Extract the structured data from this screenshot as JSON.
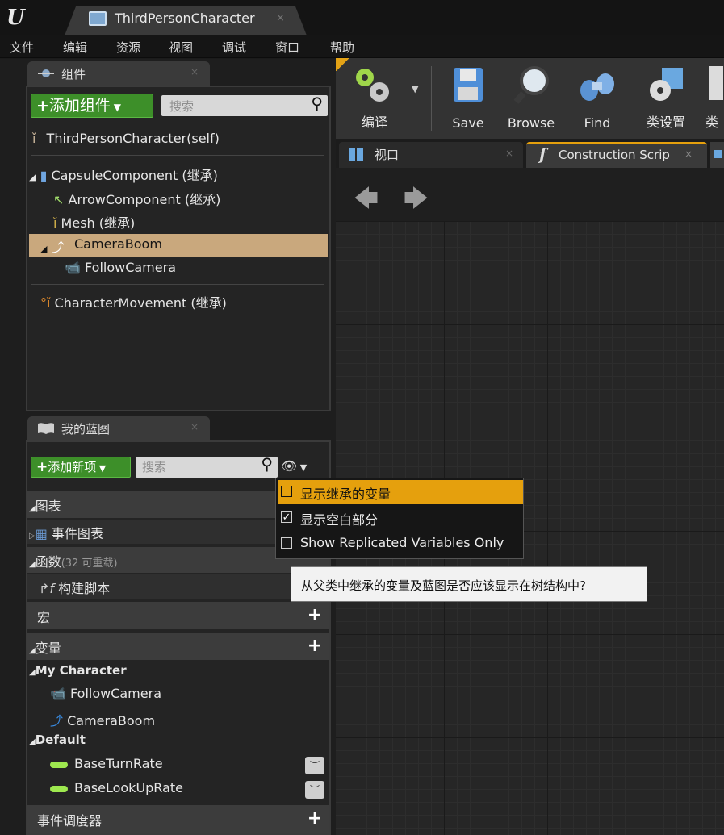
{
  "window": {
    "tab_title": "ThirdPersonCharacter",
    "tab_close": "×"
  },
  "menubar": {
    "items": [
      "文件",
      "编辑",
      "资源",
      "视图",
      "调试",
      "窗口",
      "帮助"
    ]
  },
  "components_panel": {
    "tab_label": "组件",
    "tab_close": "×",
    "add_button": "添加组件",
    "search_placeholder": "搜索",
    "self_item": "ThirdPersonCharacter(self)",
    "tree": [
      {
        "label": "CapsuleComponent (继承)"
      },
      {
        "label": "ArrowComponent (继承)"
      },
      {
        "label": "Mesh (继承)"
      },
      {
        "label": "CameraBoom"
      },
      {
        "label": "FollowCamera"
      },
      {
        "label": "CharacterMovement (继承)"
      }
    ]
  },
  "myblueprint_panel": {
    "tab_label": "我的蓝图",
    "tab_close": "×",
    "add_button": "添加新项",
    "search_placeholder": "搜索",
    "graphs_header": "图表",
    "event_graph": "事件图表",
    "functions_header": "函数",
    "functions_count": "(32 可重载)",
    "construction_script": "构建脚本",
    "macros_header": "宏",
    "variables_header": "变量",
    "group_my_character": "My Character",
    "var_follow_camera": "FollowCamera",
    "var_camera_boom": "CameraBoom",
    "group_default": "Default",
    "var_base_turn_rate": "BaseTurnRate",
    "var_base_lookup_rate": "BaseLookUpRate",
    "event_dispatchers_header": "事件调度器"
  },
  "toolbar": {
    "compile": "编译",
    "save": "Save",
    "browse": "Browse",
    "find": "Find",
    "class_settings": "类设置",
    "class_defaults_partial": "类"
  },
  "graph_tabs": {
    "viewport": "视口",
    "viewport_close": "×",
    "construction": "Construction Scrip",
    "construction_close": "×"
  },
  "view_options_dropdown": {
    "items": [
      {
        "label": "显示继承的变量",
        "checked": false,
        "highlighted": true
      },
      {
        "label": "显示空白部分",
        "checked": true,
        "highlighted": false
      },
      {
        "label": "Show Replicated Variables Only",
        "checked": false,
        "highlighted": false
      }
    ]
  },
  "tooltip": {
    "text": "从父类中继承的变量及蓝图是否应该显示在树结构中?"
  },
  "colors": {
    "accent_green": "#3d8f29",
    "selection_tan": "#c9a87d",
    "dropdown_highlight": "#e5a00d"
  }
}
